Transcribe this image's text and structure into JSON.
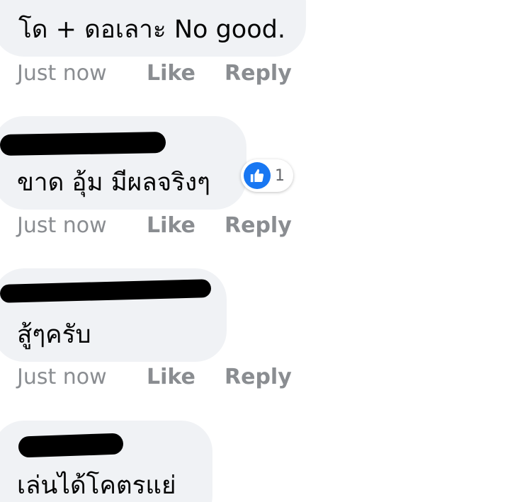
{
  "comments": [
    {
      "author": "",
      "text": "โด + ดอเลาะ No good.",
      "time": "Just now",
      "like_label": "Like",
      "reply_label": "Reply"
    },
    {
      "author": "",
      "text": "ขาด อุ้ม มีผลจริงๆ",
      "time": "Just now",
      "like_label": "Like",
      "reply_label": "Reply",
      "reactions": {
        "icon": "like-icon",
        "count": "1",
        "color": "#1877f2"
      }
    },
    {
      "author": "",
      "text": "สู้ๆครับ",
      "time": "Just now",
      "like_label": "Like",
      "reply_label": "Reply"
    },
    {
      "author": "",
      "text": "เล่นได้โคตรแย่"
    }
  ],
  "colors": {
    "bubble": "#f0f2f5",
    "meta": "#8a8d91",
    "text": "#050505",
    "redaction": "#000000"
  }
}
